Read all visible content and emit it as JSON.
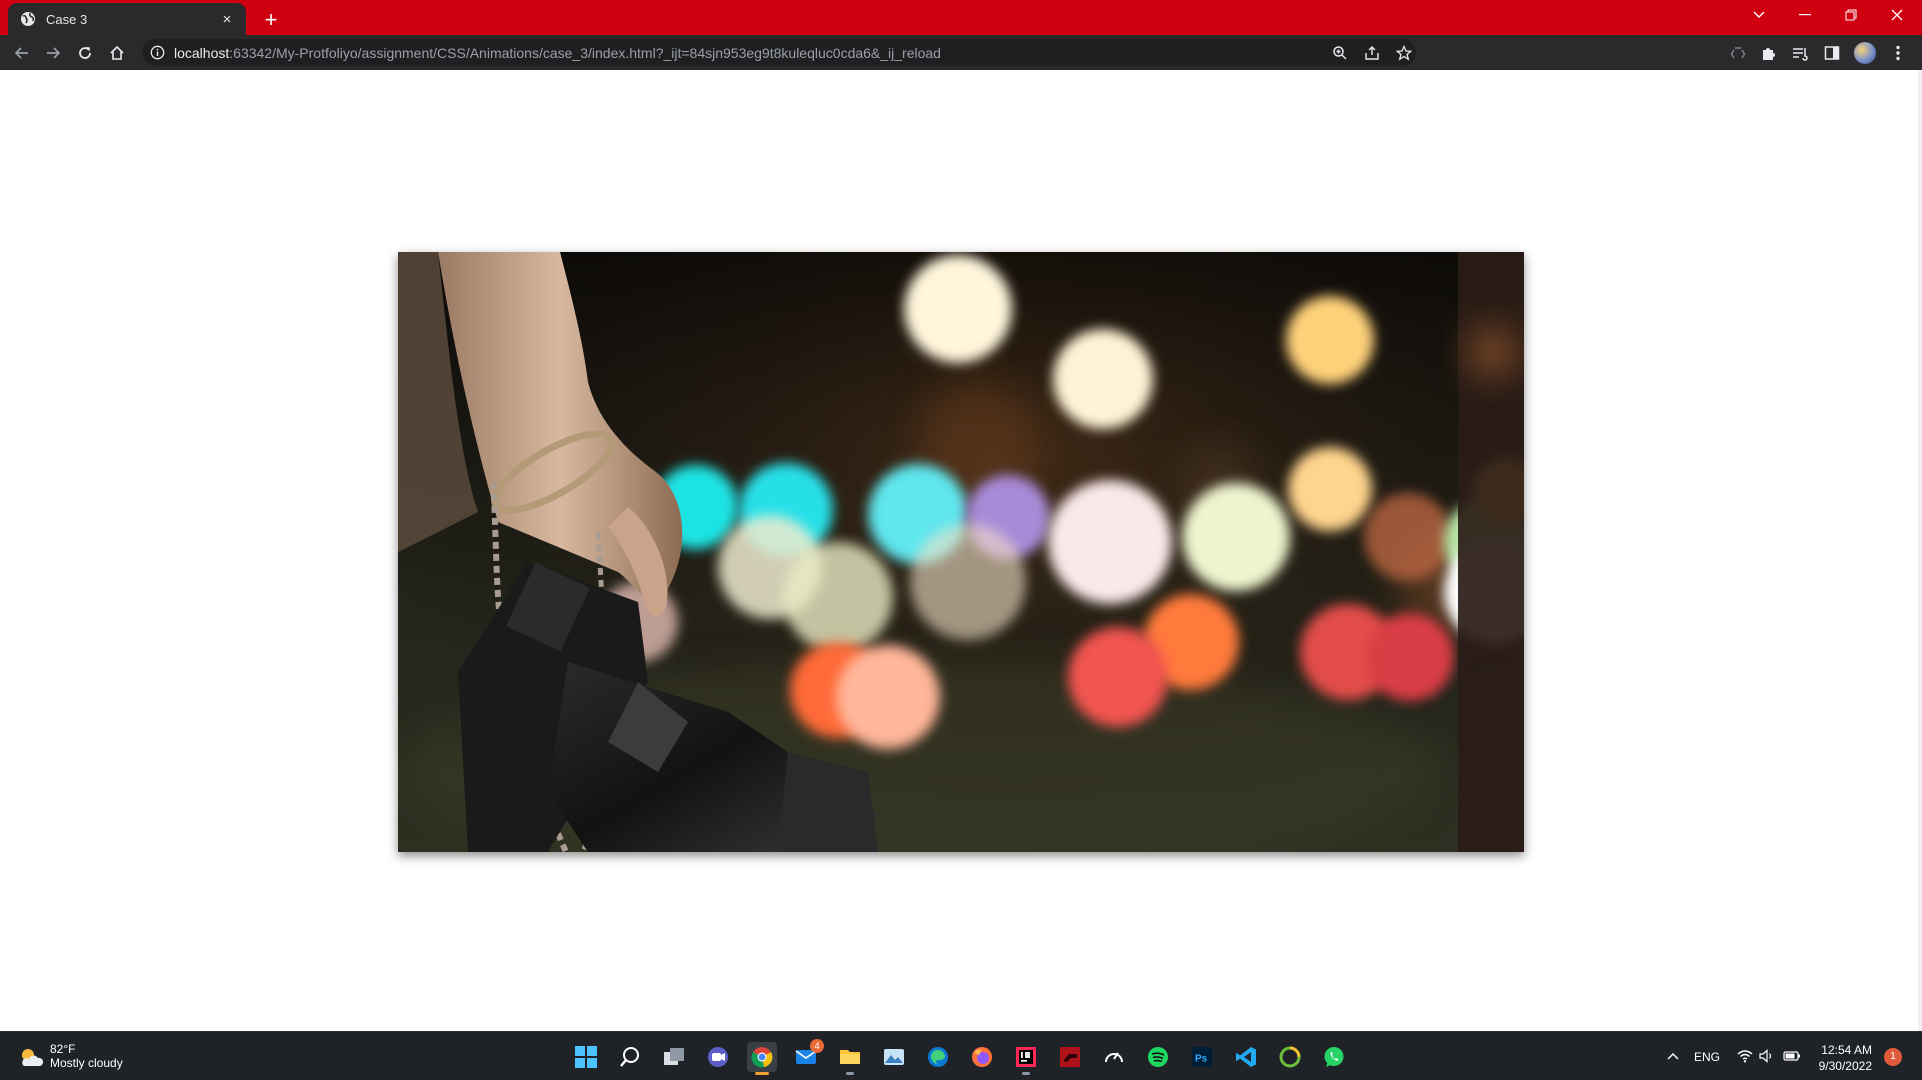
{
  "browser": {
    "tab_title": "Case 3",
    "tab_close": "×",
    "new_tab": "+",
    "url_host": "localhost",
    "url_rest": ":63342/My-Protfoliyo/assignment/CSS/Animations/case_3/index.html?_ijt=84sjn953eg9t8kuleqluc0cda6&_ij_reload",
    "theme_color": "#d10010"
  },
  "page": {
    "image_alt": "Hand in handcuffs holding a camera in front of bokeh city lights"
  },
  "taskbar": {
    "weather_temp": "82°F",
    "weather_condition": "Mostly cloudy",
    "mail_badge": "4",
    "language": "ENG",
    "time": "12:54 AM",
    "date": "9/30/2022",
    "notification_count": "1",
    "apps": [
      "start",
      "search",
      "task-view",
      "teams-chat",
      "chrome",
      "mail",
      "file-explorer",
      "photos",
      "edge",
      "firefox",
      "intellij",
      "tinkercad",
      "speedtest",
      "spotify",
      "photoshop",
      "vscode",
      "green-app",
      "whatsapp"
    ]
  }
}
